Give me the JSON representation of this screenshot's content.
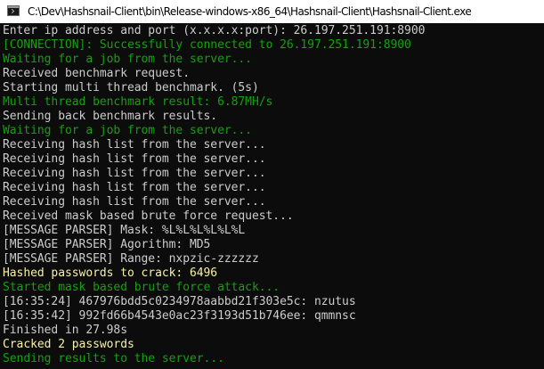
{
  "window": {
    "title": "C:\\Dev\\Hashsnail-Client\\bin\\Release-windows-x86_64\\Hashsnail-Client\\Hashsnail-Client.exe"
  },
  "colors": {
    "white": "#cccccc",
    "green": "#13a10e",
    "yellow": "#f9f1a5",
    "background": "#0c0c0c"
  },
  "console": {
    "lines": [
      {
        "text": "Enter ip address and port (x.x.x.x:port): 26.197.251.191:8900",
        "color": "white"
      },
      {
        "text": "[CONNECTION]: Successfully connected to 26.197.251.191:8900",
        "color": "green"
      },
      {
        "text": "Waiting for a job from the server...",
        "color": "green"
      },
      {
        "text": "Received benchmark request.",
        "color": "white"
      },
      {
        "text": "Starting multi thread benchmark. (5s)",
        "color": "white"
      },
      {
        "text": "Multi thread benchmark result: 6.87MH/s",
        "color": "green"
      },
      {
        "text": "Sending back benchmark results.",
        "color": "white"
      },
      {
        "text": "Waiting for a job from the server...",
        "color": "green"
      },
      {
        "text": "Receiving hash list from the server...",
        "color": "white"
      },
      {
        "text": "Receiving hash list from the server...",
        "color": "white"
      },
      {
        "text": "Receiving hash list from the server...",
        "color": "white"
      },
      {
        "text": "Receiving hash list from the server...",
        "color": "white"
      },
      {
        "text": "Receiving hash list from the server...",
        "color": "white"
      },
      {
        "text": "Received mask based brute force request...",
        "color": "white"
      },
      {
        "text": "[MESSAGE PARSER] Mask: %L%L%L%L%L%L",
        "color": "white"
      },
      {
        "text": "[MESSAGE PARSER] Agorithm: MD5",
        "color": "white"
      },
      {
        "text": "[MESSAGE PARSER] Range: nxpzic-zzzzzz",
        "color": "white"
      },
      {
        "text": "Hashed passwords to crack: 6496",
        "color": "yellow"
      },
      {
        "text": "Started mask based brute force attack...",
        "color": "green"
      },
      {
        "text": "[16:35:24] 467976bdd5c0234978aabbd21f303e5c: nzutus",
        "color": "white"
      },
      {
        "text": "[16:35:42] 992fd66b4543e0ac23f3193d51b746ee: qmmnsc",
        "color": "white"
      },
      {
        "text": "Finished in 27.98s",
        "color": "white"
      },
      {
        "text": "Cracked 2 passwords",
        "color": "yellow"
      },
      {
        "text": "Sending results to the server...",
        "color": "green"
      }
    ]
  }
}
